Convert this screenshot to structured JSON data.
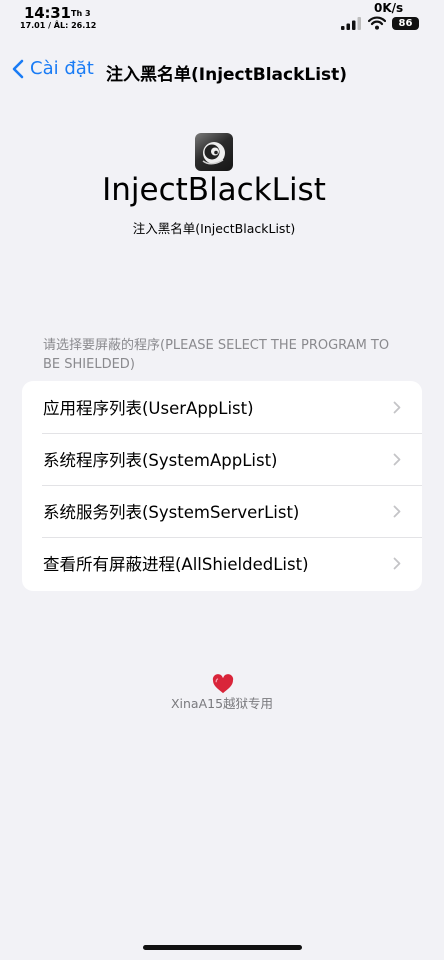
{
  "status_bar": {
    "time": "14:31",
    "day": "Th 3",
    "date": "17.01 / ÂL: 26.12",
    "speed": "0K/s",
    "battery": "86"
  },
  "nav": {
    "back_label": "Cài đặt",
    "title": "注入黑名单(InjectBlackList)"
  },
  "app": {
    "name": "InjectBlackList",
    "subtitle": "注入黑名单(InjectBlackList)"
  },
  "section": {
    "header": "请选择要屏蔽的程序(PLEASE SELECT THE PROGRAM TO BE SHIELDED)",
    "items": [
      {
        "label": "应用程序列表(UserAppList)"
      },
      {
        "label": "系统程序列表(SystemAppList)"
      },
      {
        "label": "系统服务列表(SystemServerList)"
      },
      {
        "label": "查看所有屏蔽进程(AllShieldedList)"
      }
    ]
  },
  "footer": {
    "icon": "heart-icon",
    "text": "XinaA15越狱专用"
  },
  "colors": {
    "accent": "#1a7cf5",
    "background": "#f2f2f6",
    "heart": "#d9253a"
  }
}
